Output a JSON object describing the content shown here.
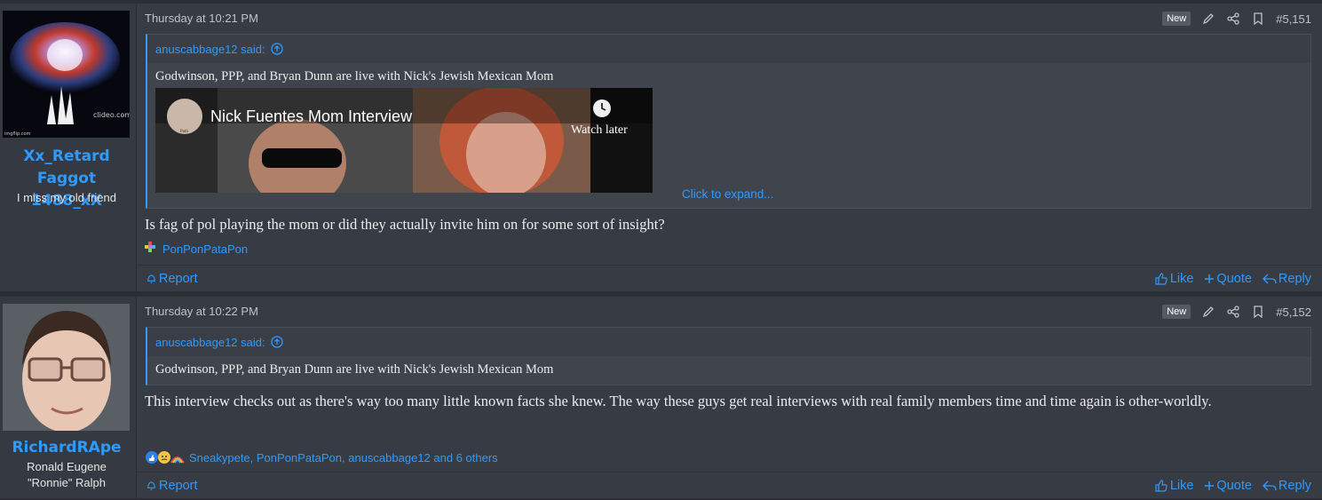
{
  "posts": [
    {
      "username_line1": "Xx_Retard",
      "username_line2": "Faggot 1488_xX",
      "user_title": "I miss my old friend",
      "avatar_watermark": "clideo.com",
      "avatar_watermark2": "imgflip.com",
      "date": "Thursday at 10:21 PM",
      "badge": "New",
      "post_number": "#5,151",
      "quote_author": "anuscabbage12 said:",
      "quote_text": "Godwinson, PPP, and Bryan Dunn are live with Nick's Jewish Mexican Mom",
      "video_title": "Nick Fuentes Mom Interview",
      "video_watch_later": "Watch later",
      "video_channel": "Path",
      "click_expand": "Click to expand...",
      "body": "Is fag of pol playing the mom or did they actually invite him on for some sort of insight?",
      "reactions": "PonPonPataPon",
      "report": "Report",
      "like": "Like",
      "quote": "Quote",
      "reply": "Reply"
    },
    {
      "username_line1": "RichardRApe",
      "user_title_line1": "Ronald Eugene",
      "user_title_line2": "\"Ronnie\" Ralph",
      "date": "Thursday at 10:22 PM",
      "badge": "New",
      "post_number": "#5,152",
      "quote_author": "anuscabbage12 said:",
      "quote_text": "Godwinson, PPP, and Bryan Dunn are live with Nick's Jewish Mexican Mom",
      "body": "This interview checks out as there's way too many little known facts she knew. The way these guys get real interviews with real family members time and time again is other-worldly.",
      "reactions": "Sneakypete, PonPonPataPon, anuscabbage12 and 6 others",
      "report": "Report",
      "like": "Like",
      "quote": "Quote",
      "reply": "Reply"
    }
  ],
  "colors": {
    "accent": "#2f9bff",
    "background": "#2b2e34",
    "post_bg": "#373b43",
    "user_col_bg": "#353941"
  },
  "icons": [
    "arrow-up-circle-icon",
    "pencil-icon",
    "share-icon",
    "bookmark-icon",
    "bell-icon",
    "thumbs-up-icon",
    "plus-icon",
    "reply-icon",
    "clock-icon"
  ]
}
